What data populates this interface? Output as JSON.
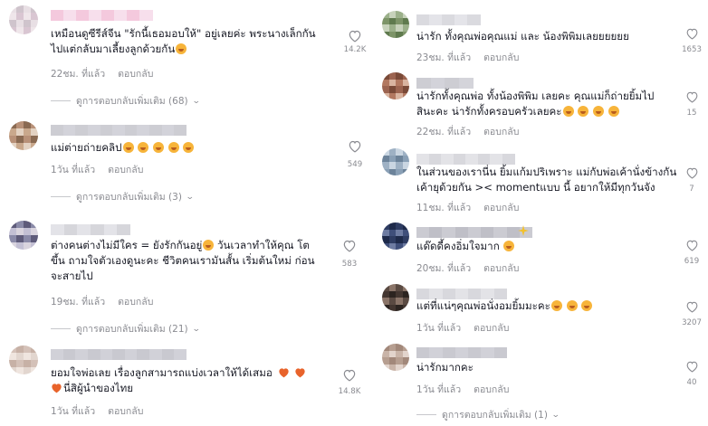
{
  "ui": {
    "reply_label": "ตอบกลับ",
    "colors": {
      "text": "#161823",
      "muted": "#8a8b91",
      "emoji": "#f7b43a",
      "heart": "#e8632b"
    }
  },
  "left": [
    {
      "avatar_colors": [
        "#e8dfe4",
        "#d9c6d2",
        "#cfc4cc",
        "#efe6ea"
      ],
      "name_colors": [
        "#f3c4da",
        "#e8a8c8",
        "#f7dcea",
        "#ecb5cf"
      ],
      "lines": [
        "เหมือนดูซีรีส์จีน \"รักนี้เธอมอบให้\" อยู่เลยค่ะ พระนางเล็กกัน",
        "ไปแต่กลับมาเลี้ยงลูกด้วยกัน"
      ],
      "line_emojis": [
        [],
        [
          "smile-emoji"
        ]
      ],
      "time": "22ชม. ที่แล้ว",
      "likes": "14.2K",
      "more": "ดูการตอบกลับเพิ่มเติม (68)"
    },
    {
      "avatar_colors": [
        "#c9a88c",
        "#8a6a52",
        "#e3d2c2",
        "#b89178"
      ],
      "name_colors": [
        "#d8d8dc",
        "#c8c8cf",
        "#e4e4e8",
        "#cfcfd6"
      ],
      "lines": [
        "แม่ต่ายถ่ายคลิป"
      ],
      "line_emojis": [
        [
          "smile-emoji",
          "smile-emoji",
          "smile-emoji",
          "smile-emoji",
          "smile-emoji"
        ]
      ],
      "time": "1วัน ที่แล้ว",
      "likes": "549",
      "more": "ดูการตอบกลับเพิ่มเติม (3)"
    },
    {
      "avatar_colors": [
        "#8a8aa8",
        "#c3c0d4",
        "#5e5b7a",
        "#d9d4de"
      ],
      "name_colors": [
        "#d2d2d8",
        "#bdbdc6",
        "#e1e1e6",
        "#cacad2"
      ],
      "lines": [
        "ต่างคนต่างไม่มีใคร = ยังรักกันอยู่",
        "ขึ้น ถามใจตัวเองดูนะคะ ชีวิตคนเรามันสั้น เริ่มต้นใหม่ ก่อน",
        "จะสายไป"
      ],
      "line_emojis": [
        [
          "smile-emoji"
        ],
        [],
        []
      ],
      "line0_tail": " วันเวลาทำให้คุณ โต",
      "time": "19ชม. ที่แล้ว",
      "likes": "583",
      "more": "ดูการตอบกลับเพิ่มเติม (21)"
    },
    {
      "avatar_colors": [
        "#e2d6cf",
        "#c7b1a6",
        "#efe5df",
        "#d4c1b8"
      ],
      "name_colors": [
        "#d6d6dc",
        "#c4c4cc",
        "#e2e2e7",
        "#cdcdd4"
      ],
      "lines": [
        "ยอมใจพ่อเลย เรื่องลูกสามารถแบ่งเวลาให้ได้เสมอ",
        "นี่สิผู้นำของไทย"
      ],
      "line_emojis": [
        [
          "heart-emoji",
          "heart-emoji"
        ],
        []
      ],
      "line1_lead_heart": true,
      "time": "1วัน ที่แล้ว",
      "likes": "14.8K"
    }
  ],
  "right": [
    {
      "avatar_colors": [
        "#9bb08a",
        "#5f7a4e",
        "#c7d2bb",
        "#7d9468"
      ],
      "name_colors": [
        "#d6d6dc",
        "#c4c4cc",
        "#e2e2e7",
        "#cdcdd4"
      ],
      "lines": [
        "น่ารัก ทั้งคุณพ่อคุณแม่ และ น้องพิพิมเลยยยยยย"
      ],
      "line_emojis": [
        []
      ],
      "time": "23ชม. ที่แล้ว",
      "likes": "1653"
    },
    {
      "avatar_colors": [
        "#b27860",
        "#7a4a38",
        "#d9b4a0",
        "#9c6450"
      ],
      "name_colors": [
        "#d8d8dc",
        "#c8c8cf",
        "#e4e4e8",
        "#cfcfd6"
      ],
      "lines": [
        "น่ารักทั้งคุณพ่อ ทั้งน้องพิพิม เลยคะ คุณแม่ก็ถ่ายยิ้มไป",
        "สินะคะ น่ารักทั้งครอบครัวเลยคะ"
      ],
      "line_emojis": [
        [],
        [
          "smile-emoji",
          "smile-emoji",
          "smile-emoji",
          "smile-emoji"
        ]
      ],
      "time": "22ชม. ที่แล้ว",
      "likes": "15"
    },
    {
      "avatar_colors": [
        "#9eb1c4",
        "#6c839a",
        "#cad6e2",
        "#8aa0b6"
      ],
      "name_colors": [
        "#d4d4da",
        "#c1c1c9",
        "#e0e0e5",
        "#cbcbd2"
      ],
      "lines": [
        "ในส่วนของเรานี่น ยิ้มแก้มปริเพราะ แม่กับพ่อเค้านั่งข้างกัน",
        "เค้ายุด้วยกัน >< momentแบบ นี้ อยากให้มีทุกวันจัง"
      ],
      "line_emojis": [
        [],
        []
      ],
      "time": "11ชม. ที่แล้ว",
      "likes": "7"
    },
    {
      "avatar_colors": [
        "#3f4f7a",
        "#1e2a4a",
        "#6e7ca2",
        "#2e3c62"
      ],
      "name_colors": [
        "#cfcfd6",
        "#b9b9c2",
        "#dcdce2",
        "#c6c6ce"
      ],
      "lines": [
        "แด๊ดดี้คงอิ่มใจมาก"
      ],
      "line_emojis": [
        [
          "smile-emoji"
        ]
      ],
      "time": "20ชม. ที่แล้ว",
      "likes": "619"
    },
    {
      "avatar_colors": [
        "#5a4a42",
        "#2c2420",
        "#8a7468",
        "#433630"
      ],
      "name_colors": [
        "#d4d4da",
        "#c1c1c9",
        "#e0e0e5",
        "#cbcbd2"
      ],
      "lines": [
        "แต่ที่แน่ๆคุณพ่อนั่งอมยิ้มมะคะ"
      ],
      "line_emojis": [
        [
          "smile-emoji",
          "smile-emoji",
          "smile-emoji"
        ]
      ],
      "time": "1วัน ที่แล้ว",
      "likes": "3207"
    },
    {
      "avatar_colors": [
        "#c9b4a8",
        "#a2887a",
        "#e2d4cc",
        "#b69e90"
      ],
      "name_colors": [
        "#d6d6dc",
        "#c4c4cc",
        "#e2e2e7",
        "#cdcdd4"
      ],
      "lines": [
        "น่ารักมากคะ"
      ],
      "line_emojis": [
        []
      ],
      "time": "1วัน ที่แล้ว",
      "likes": "40",
      "more": "ดูการตอบกลับเพิ่มเติม (1)"
    }
  ]
}
